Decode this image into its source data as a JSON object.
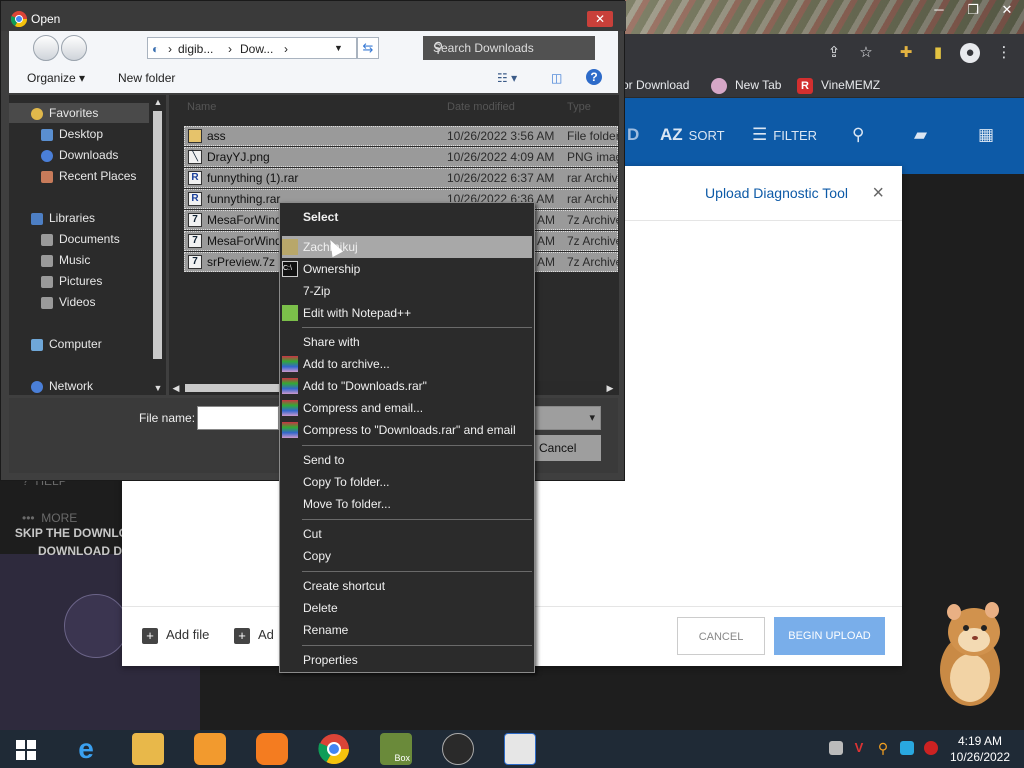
{
  "browser": {
    "bookmarks": [
      "or Download",
      "New Tab",
      "VineMEMZ"
    ],
    "site_tools": [
      "SORT",
      "FILTER"
    ],
    "left_panel": {
      "help": "HELP",
      "more": "MORE",
      "promo": "SKIP THE DOWNLOAD PAGE, DOWNLOAD DIRECT!"
    }
  },
  "upload_modal": {
    "title": "Upload Diagnostic Tool",
    "close": "×",
    "add_file": "Add file",
    "add_folder": "Ad",
    "cancel": "CANCEL",
    "begin_upload": "BEGIN UPLOAD"
  },
  "dialog": {
    "title": "Open",
    "close": "✕",
    "address": {
      "part1": "digib...",
      "part2": "Dow..."
    },
    "search_placeholder": "Search Downloads",
    "organize": "Organize ▾",
    "new_folder": "New folder",
    "nav": {
      "favorites": "Favorites",
      "desktop": "Desktop",
      "downloads": "Downloads",
      "recent": "Recent Places",
      "libraries": "Libraries",
      "documents": "Documents",
      "music": "Music",
      "pictures": "Pictures",
      "videos": "Videos",
      "computer": "Computer",
      "network": "Network"
    },
    "columns": [
      "Name",
      "Date modified",
      "Type"
    ],
    "files": [
      {
        "name": "ass",
        "date": "10/26/2022 3:56 AM",
        "type": "File folder"
      },
      {
        "name": "DrayYJ.png",
        "date": "10/26/2022 4:09 AM",
        "type": "PNG image"
      },
      {
        "name": "funnything (1).rar",
        "date": "10/26/2022 6:37 AM",
        "type": "rar Archive"
      },
      {
        "name": "funnything.rar",
        "date": "10/26/2022 6:36 AM",
        "type": "rar Archive"
      },
      {
        "name": "MesaForWind",
        "date": "AM",
        "type": "7z Archive"
      },
      {
        "name": "MesaForWind",
        "date": "AM",
        "type": "7z Archive"
      },
      {
        "name": "srPreview.7z",
        "date": "AM",
        "type": "7z Archive"
      }
    ],
    "file_name_label": "File name:",
    "cancel": "Cancel"
  },
  "context_menu": {
    "items": [
      "Select",
      "Zachmikuj",
      "Ownership",
      "7-Zip",
      "Edit with Notepad++",
      "Share with",
      "Add to archive...",
      "Add to \"Downloads.rar\"",
      "Compress and email...",
      "Compress to \"Downloads.rar\" and email",
      "Send to",
      "Copy To folder...",
      "Move To folder...",
      "Cut",
      "Copy",
      "Create shortcut",
      "Delete",
      "Rename",
      "Properties"
    ]
  },
  "taskbar": {
    "time": "4:19 AM",
    "date": "10/26/2022",
    "box_label": "Box"
  }
}
